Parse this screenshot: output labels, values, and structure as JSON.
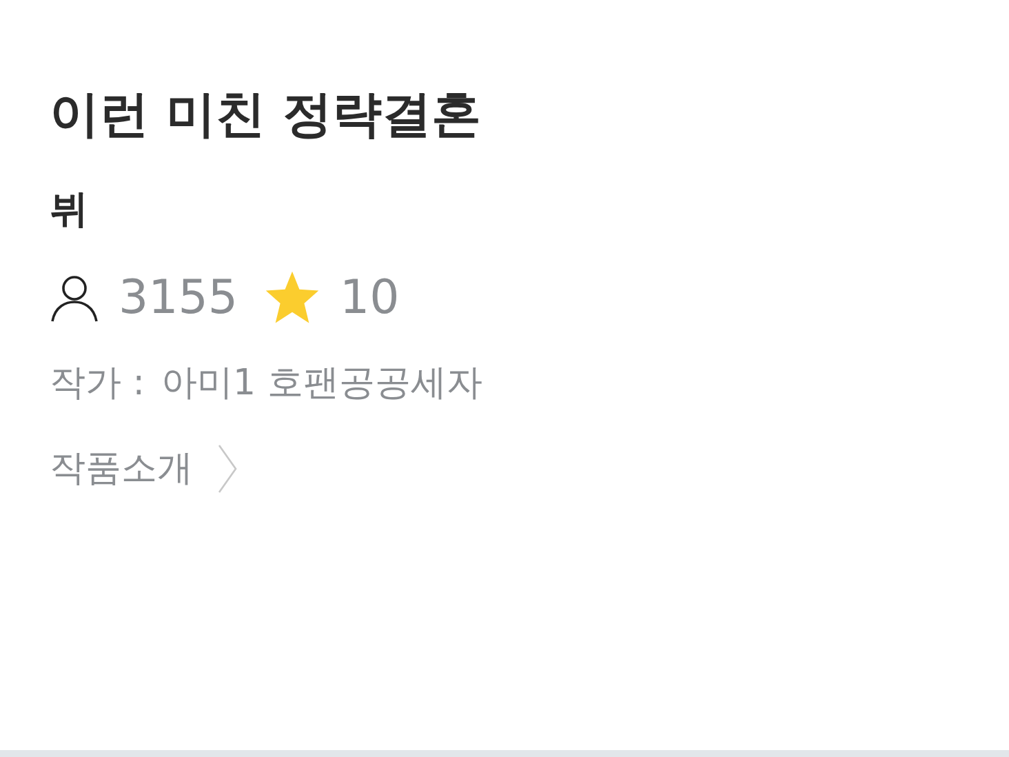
{
  "title": "이런 미친 정략결혼",
  "subtitle": "뷔",
  "stats": {
    "views": "3155",
    "stars": "10"
  },
  "author": {
    "label": "작가 :",
    "name": "아미1 호팬공공세자"
  },
  "intro_link": "작품소개"
}
